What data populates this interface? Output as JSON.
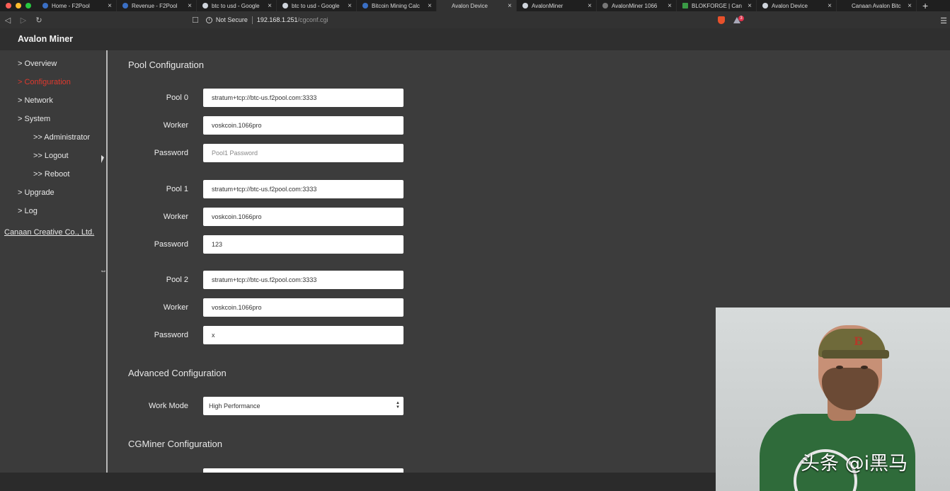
{
  "browser": {
    "tabs": [
      {
        "title": "Home - F2Pool",
        "icon": "globe-blue"
      },
      {
        "title": "Revenue - F2Pool",
        "icon": "globe-blue"
      },
      {
        "title": "btc to usd - Google",
        "icon": "google"
      },
      {
        "title": "btc to usd - Google",
        "icon": "google"
      },
      {
        "title": "Bitcoin Mining Calc",
        "icon": "facebook"
      },
      {
        "title": "Avalon Device",
        "icon": "none"
      },
      {
        "title": "AvalonMiner",
        "icon": "globe"
      },
      {
        "title": "AvalonMiner 1066",
        "icon": "globe-dim"
      },
      {
        "title": "BLOKFORGE | Can",
        "icon": "green-square"
      },
      {
        "title": "Avalon Device",
        "icon": "globe"
      },
      {
        "title": "Canaan Avalon Bitc",
        "icon": "leaf"
      }
    ],
    "active_tab_index": 5,
    "security_label": "Not Secure",
    "url_host": "192.168.1.251",
    "url_path": "/cgconf.cgi",
    "alert_count": "3"
  },
  "header": {
    "brand": "Avalon Miner"
  },
  "sidebar": {
    "items": [
      {
        "label": "> Overview"
      },
      {
        "label": "> Configuration",
        "active": true
      },
      {
        "label": "> Network"
      },
      {
        "label": "> System"
      },
      {
        "label": ">> Administrator"
      },
      {
        "label": ">> Logout"
      },
      {
        "label": ">> Reboot"
      },
      {
        "label": "> Upgrade"
      },
      {
        "label": "> Log"
      }
    ],
    "company": "Canaan Creative Co., Ltd."
  },
  "pool_config": {
    "title": "Pool Configuration",
    "pools": [
      {
        "label": "Pool 0",
        "url": "stratum+tcp://btc-us.f2pool.com:3333",
        "worker_label": "Worker",
        "worker": "voskcoin.1066pro",
        "password_label": "Password",
        "password": "",
        "password_placeholder": "Pool1 Password"
      },
      {
        "label": "Pool 1",
        "url": "stratum+tcp://btc-us.f2pool.com:3333",
        "worker_label": "Worker",
        "worker": "voskcoin.1066pro",
        "password_label": "Password",
        "password": "123",
        "password_placeholder": ""
      },
      {
        "label": "Pool 2",
        "url": "stratum+tcp://btc-us.f2pool.com:3333",
        "worker_label": "Worker",
        "worker": "voskcoin.1066pro",
        "password_label": "Password",
        "password": "x",
        "password_placeholder": ""
      }
    ]
  },
  "advanced_config": {
    "title": "Advanced Configuration",
    "work_mode_label": "Work Mode",
    "work_mode_value": "High Performance"
  },
  "cgminer_config": {
    "title": "CGMiner Configuration"
  },
  "overlay": {
    "watermark": "头条 @i黑马"
  },
  "colors": {
    "accent_active": "#e0392e",
    "background": "#3c3c3c",
    "header": "#2f2f2f"
  }
}
